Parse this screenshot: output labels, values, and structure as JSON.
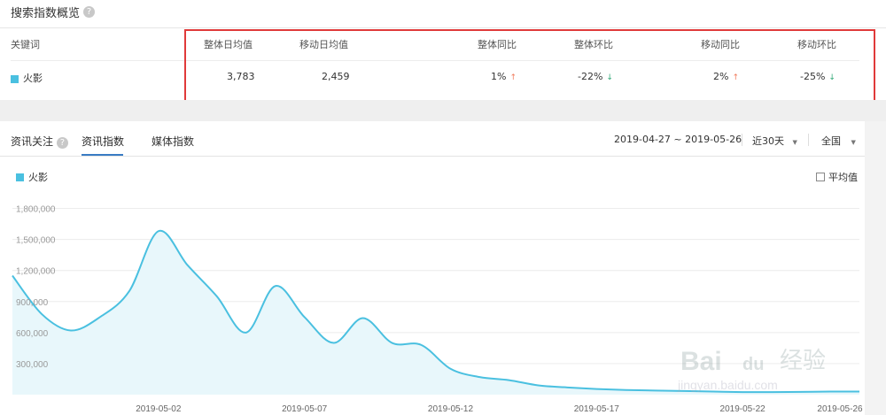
{
  "overview": {
    "title": "搜索指数概览",
    "headers": {
      "keyword": "关键词",
      "overall_daily": "整体日均值",
      "mobile_daily": "移动日均值",
      "overall_yoy": "整体同比",
      "overall_mom": "整体环比",
      "mobile_yoy": "移动同比",
      "mobile_mom": "移动环比"
    },
    "row": {
      "keyword": "火影",
      "overall_daily": "3,783",
      "mobile_daily": "2,459",
      "overall_yoy": "1%",
      "overall_mom": "-22%",
      "mobile_yoy": "2%",
      "mobile_mom": "-25%"
    },
    "arrows": {
      "up": "↑",
      "down": "↓"
    }
  },
  "tabs": {
    "news_focus": "资讯关注",
    "news_index": "资讯指数",
    "media_index": "媒体指数"
  },
  "controls": {
    "date_range": "2019-04-27 ~ 2019-05-26",
    "period": "近30天",
    "region": "全国",
    "caret": "▼"
  },
  "legend": {
    "series": "火影",
    "avg_label": "平均值"
  },
  "colors": {
    "series": "#4ac0e0",
    "fill": "#e8f7fb",
    "accent": "#3a7cc4",
    "up": "#f07b5c",
    "down": "#2fa876",
    "highlight": "#e03a3a"
  },
  "chart_data": {
    "type": "area",
    "ylim": [
      0,
      1950000
    ],
    "y_ticks": [
      300000,
      600000,
      900000,
      1200000,
      1500000,
      1800000
    ],
    "y_tick_labels": [
      "300,000",
      "600,000",
      "900,000",
      "1,200,000",
      "1,500,000",
      "1,800,000"
    ],
    "x_tick_labels": [
      {
        "label": "2019-05-02",
        "index": 5
      },
      {
        "label": "2019-05-07",
        "index": 10
      },
      {
        "label": "2019-05-12",
        "index": 15
      },
      {
        "label": "2019-05-17",
        "index": 20
      },
      {
        "label": "2019-05-22",
        "index": 25
      },
      {
        "label": "2019-05-26",
        "index": 29
      }
    ],
    "series": [
      {
        "values": [
          1150000,
          780000,
          620000,
          750000,
          1000000,
          1580000,
          1250000,
          950000,
          600000,
          1050000,
          750000,
          500000,
          740000,
          500000,
          480000,
          250000,
          170000,
          140000,
          90000,
          70000,
          55000,
          45000,
          40000,
          35000,
          30000,
          25000,
          25000,
          27000,
          30000,
          30000
        ]
      }
    ]
  },
  "watermark": {
    "brand": "Bai",
    "brand2": "du",
    "jingyan": "经验",
    "url": "jingyan.baidu.com"
  }
}
